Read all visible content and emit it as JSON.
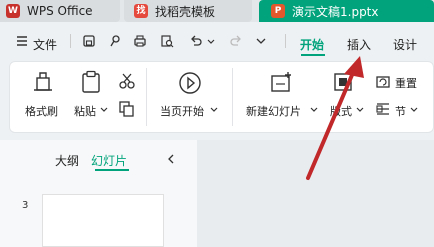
{
  "tabs": [
    {
      "label": "WPS Office"
    },
    {
      "label": "找稻壳模板"
    },
    {
      "label": "演示文稿1.pptx"
    }
  ],
  "menu": {
    "file": "文件",
    "tabs": [
      "开始",
      "插入",
      "设计"
    ],
    "active_tab": "开始"
  },
  "ribbon": {
    "format_painter": "格式刷",
    "paste": "粘贴",
    "from_current": "当页开始",
    "new_slide": "新建幻灯片",
    "layout": "版式",
    "reset": "重置",
    "section": "节"
  },
  "panel": {
    "outline": "大纲",
    "slides": "幻灯片",
    "slide_number": "3"
  },
  "colors": {
    "accent": "#00a37b",
    "arrow": "#c0282a"
  }
}
